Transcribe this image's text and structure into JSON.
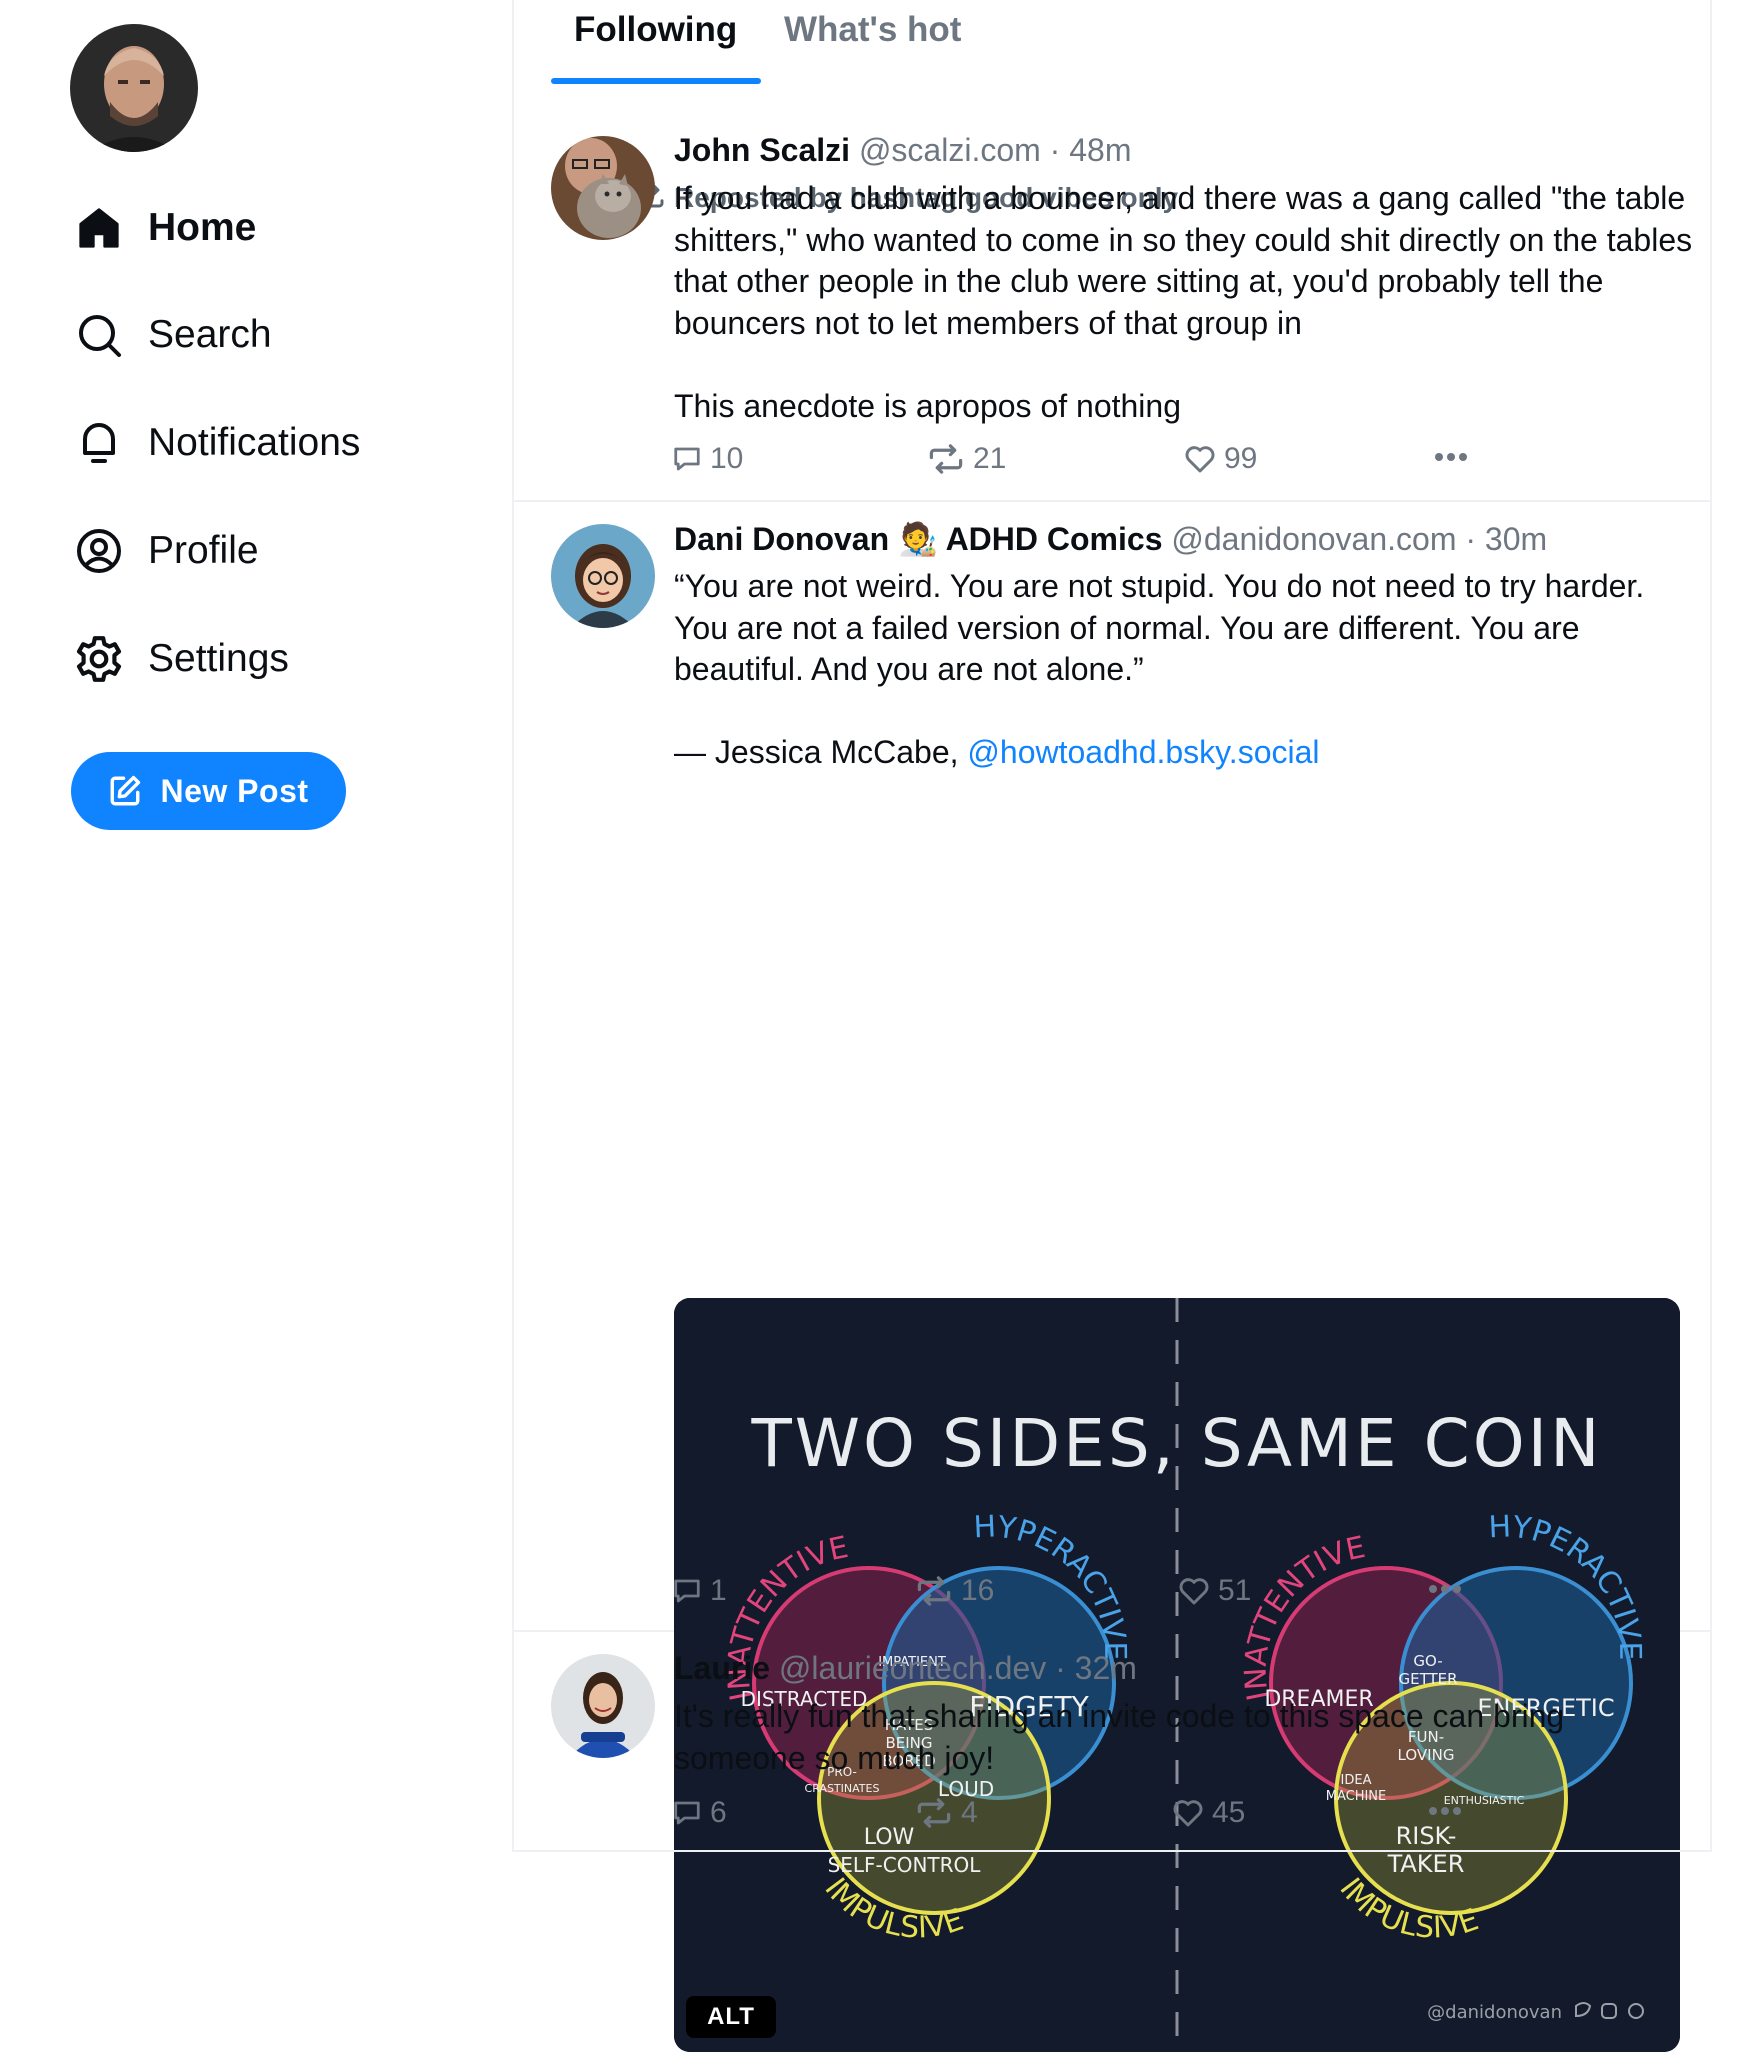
{
  "sidebar": {
    "nav": [
      {
        "label": "Home",
        "icon": "home-icon",
        "active": true
      },
      {
        "label": "Search",
        "icon": "search-icon"
      },
      {
        "label": "Notifications",
        "icon": "bell-icon"
      },
      {
        "label": "Profile",
        "icon": "profile-icon"
      },
      {
        "label": "Settings",
        "icon": "gear-icon"
      }
    ],
    "new_post_label": "New Post"
  },
  "tabs": [
    {
      "label": "Following",
      "active": true
    },
    {
      "label": "What's hot"
    }
  ],
  "colors": {
    "accent": "#1083fe",
    "muted": "#6e7781",
    "text": "#0b0f14"
  },
  "posts": [
    {
      "repost_by": "Reposted by hashtag good vibes only",
      "name": "John Scalzi",
      "handle": "@scalzi.com",
      "separator": "·",
      "time": "48m",
      "text": "If you had a club with a bouncer, and there was a gang called \"the table shitters,\" who wanted to come in so they could shit directly on the tables that other people in the club were sitting at, you'd probably tell the bouncers not to let members of that group in\n\nThis anecdote is apropos of nothing",
      "replies": "10",
      "reposts": "21",
      "likes": "99"
    },
    {
      "name": "Dani Donovan 🧑‍🎨 ADHD Comics",
      "handle": "@danidonovan.com",
      "separator": "·",
      "time": "30m",
      "text": "“You are not weird. You are not stupid. You do not need to try harder. You are not a failed version of normal. You are different. You are beautiful. And you are not alone.”\n\n— Jessica McCabe, ",
      "mention": "@howtoadhd.bsky.social",
      "image": {
        "title": "TWO SIDES, SAME COIN",
        "alt_badge": "ALT",
        "watermark": "@danidonovan",
        "left": {
          "circles": [
            "INATTENTIVE",
            "HYPERACTIVE",
            "IMPULSIVE"
          ],
          "labels": [
            "DISTRACTED",
            "IMPATIENT",
            "FIDGETY",
            "HATES",
            "BEING",
            "BORED",
            "PRO-",
            "CRASTINATES",
            "LOUD",
            "LOW",
            "SELF-CONTROL"
          ]
        },
        "right": {
          "circles": [
            "INATTENTIVE",
            "HYPERACTIVE",
            "IMPULSIVE"
          ],
          "labels": [
            "DREAMER",
            "GO-",
            "GETTER",
            "ENERGETIC",
            "FUN-",
            "LOVING",
            "IDEA",
            "MACHINE",
            "ENTHUSIASTIC",
            "RISK-",
            "TAKER"
          ]
        }
      },
      "replies": "1",
      "reposts": "16",
      "likes": "51"
    },
    {
      "name": "Laurie",
      "handle": "@laurieontech.dev",
      "separator": "·",
      "time": "32m",
      "text": "It's really fun that sharing an invite code to this space can bring someone so much joy!",
      "replies": "6",
      "reposts": "4",
      "likes": "45"
    }
  ]
}
